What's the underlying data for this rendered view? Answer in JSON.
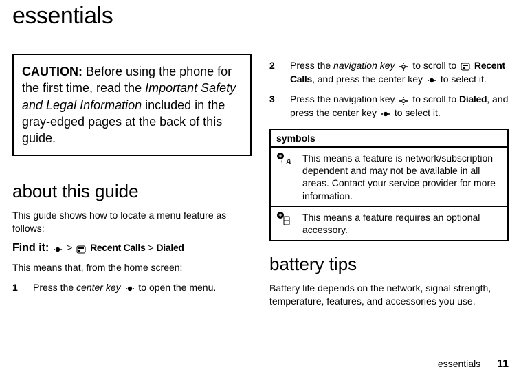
{
  "title": "essentials",
  "caution": {
    "label": "CAUTION:",
    "pre": " Before using the phone for the first time, read the ",
    "italic": "Important Safety and Legal Information",
    "post": " included in the gray-edged pages at the back of this guide."
  },
  "about": {
    "heading": "about this guide",
    "intro": "This guide shows how to locate a menu feature as follows:",
    "findit_label": "Find it:",
    "findit_sep": ">",
    "findit_recent": "Recent Calls",
    "findit_dialed": "Dialed",
    "means": "This means that, from the home screen:",
    "steps": [
      {
        "num": "1",
        "t1": "Press the ",
        "it1": "center key",
        "t2": " to open the menu."
      },
      {
        "num": "2",
        "t1": "Press the ",
        "it1": "navigation key",
        "t2": " to scroll to ",
        "b1": "Recent Calls",
        "t3": ", and press the center key ",
        "t4": " to select it."
      },
      {
        "num": "3",
        "t1": "Press the navigation key ",
        "t2": " to scroll to ",
        "b1": "Dialed",
        "t3": ", and press the center key ",
        "t4": " to select it."
      }
    ]
  },
  "symbols": {
    "header": "symbols",
    "rows": [
      {
        "text": "This means a feature is network/subscription dependent and may not be available in all areas. Contact your service provider for more information."
      },
      {
        "text": "This means a feature requires an optional accessory."
      }
    ]
  },
  "battery": {
    "heading": "battery tips",
    "text": "Battery life depends on the network, signal strength, temperature, features, and accessories you use."
  },
  "footer": {
    "label": "essentials",
    "page": "11"
  }
}
